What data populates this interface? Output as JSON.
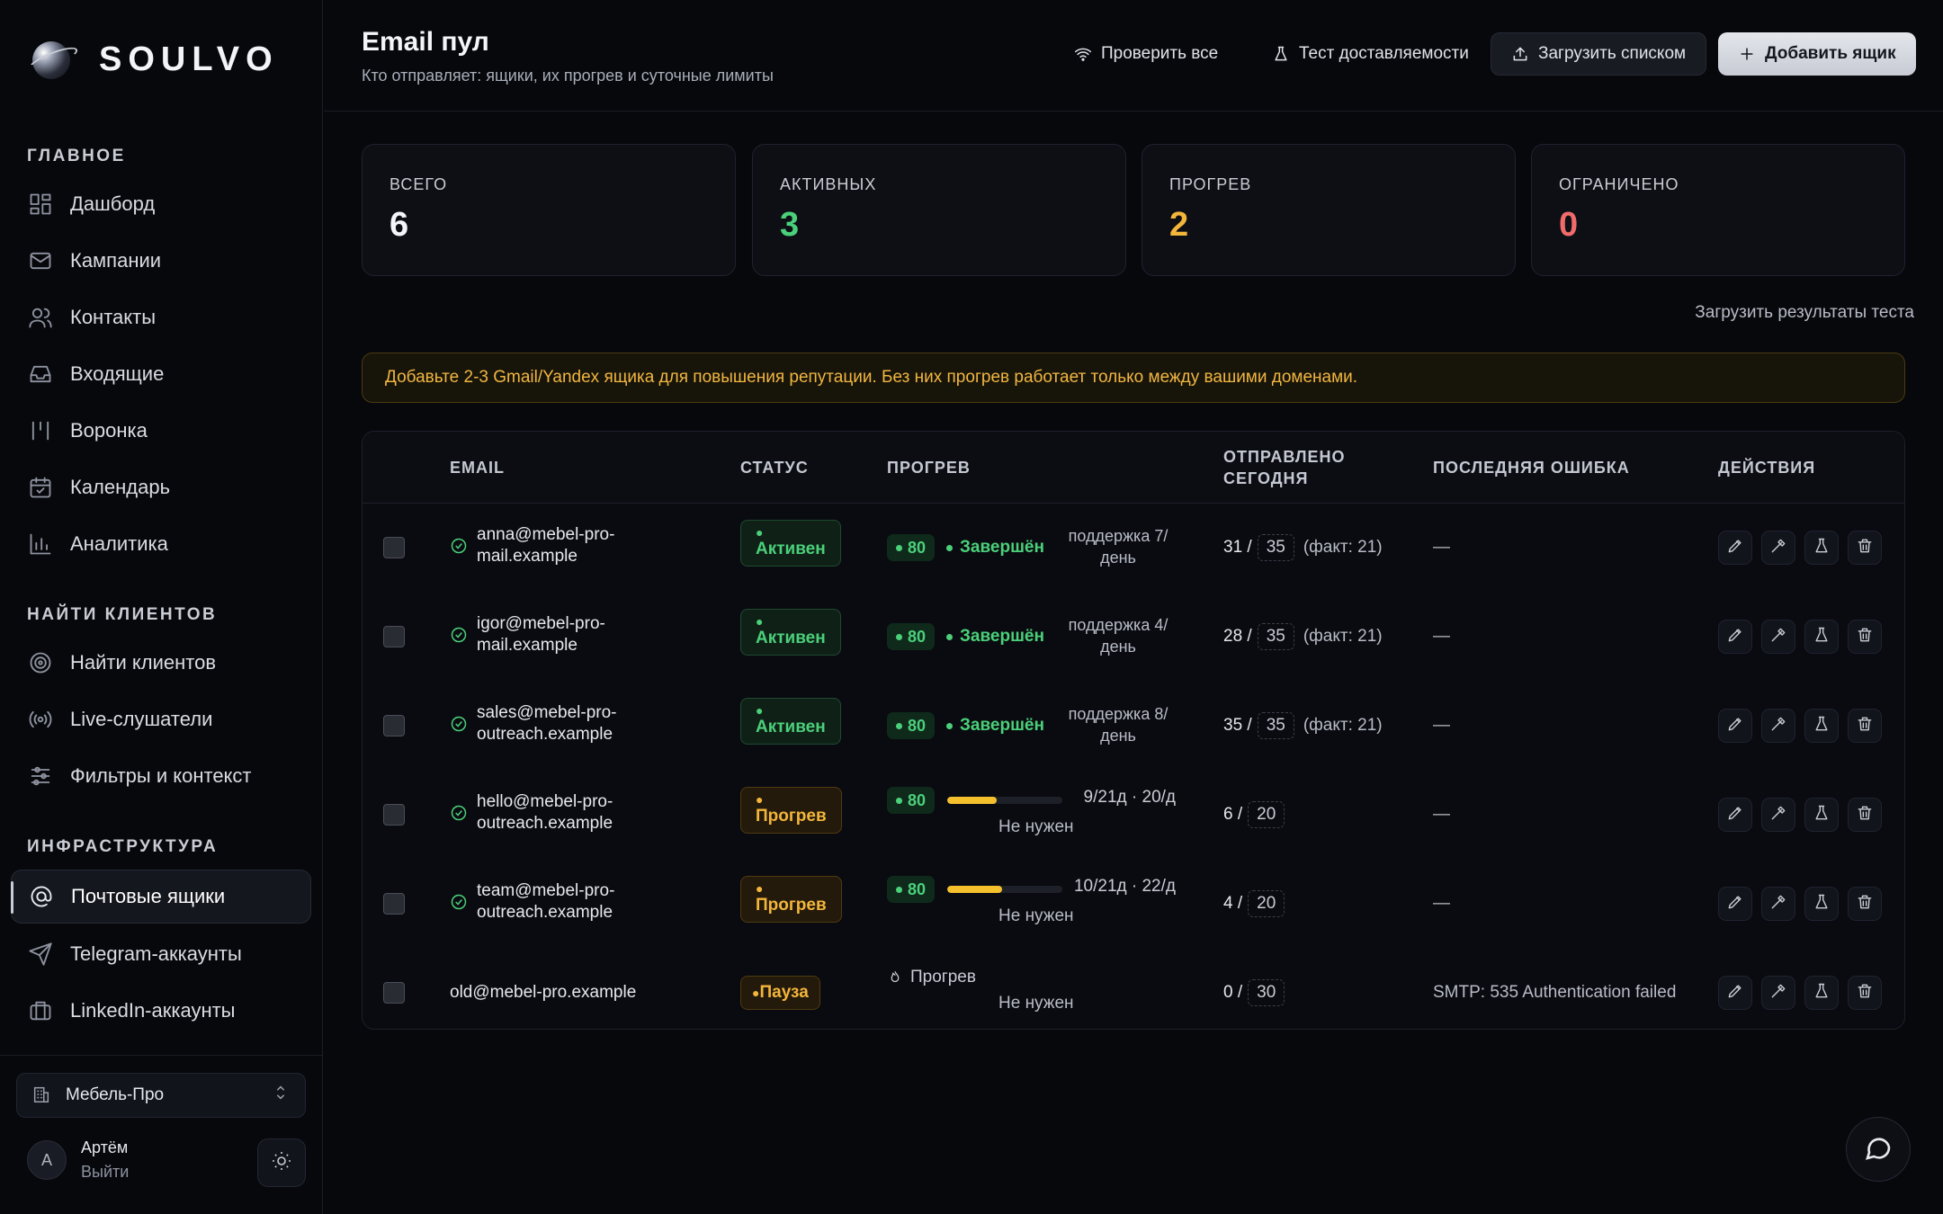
{
  "brand": {
    "name": "SOULVO"
  },
  "sidebar": {
    "sections": [
      {
        "title": "ГЛАВНОЕ",
        "items": [
          {
            "label": "Дашборд",
            "icon": "dashboard-icon"
          },
          {
            "label": "Кампании",
            "icon": "mail-icon"
          },
          {
            "label": "Контакты",
            "icon": "users-icon"
          },
          {
            "label": "Входящие",
            "icon": "inbox-icon"
          },
          {
            "label": "Воронка",
            "icon": "funnel-icon"
          },
          {
            "label": "Календарь",
            "icon": "calendar-icon"
          },
          {
            "label": "Аналитика",
            "icon": "analytics-icon"
          }
        ]
      },
      {
        "title": "НАЙТИ КЛИЕНТОВ",
        "items": [
          {
            "label": "Найти клиентов",
            "icon": "target-icon"
          },
          {
            "label": "Live-слушатели",
            "icon": "broadcast-icon"
          },
          {
            "label": "Фильтры и контекст",
            "icon": "sliders-icon"
          }
        ]
      },
      {
        "title": "ИНФРАСТРУКТУРА",
        "items": [
          {
            "label": "Почтовые ящики",
            "icon": "at-icon",
            "active": true
          },
          {
            "label": "Telegram-аккаунты",
            "icon": "send-icon"
          },
          {
            "label": "LinkedIn-аккаунты",
            "icon": "briefcase-icon"
          }
        ]
      }
    ],
    "org": {
      "name": "Мебель-Про"
    },
    "user": {
      "initial": "A",
      "name": "Артём",
      "logout": "Выйти"
    }
  },
  "header": {
    "title": "Email пул",
    "subtitle": "Кто отправляет: ящики, их прогрев и суточные лимиты",
    "buttons": {
      "check_all": "Проверить все",
      "deliverability": "Тест доставляемости",
      "upload_list": "Загрузить списком",
      "add_box": "Добавить ящик"
    }
  },
  "stats": [
    {
      "label": "ВСЕГО",
      "value": "6",
      "color": "#f4f5f8"
    },
    {
      "label": "АКТИВНЫХ",
      "value": "3",
      "color": "#4bd07a"
    },
    {
      "label": "ПРОГРЕВ",
      "value": "2",
      "color": "#f3b63b"
    },
    {
      "label": "ОГРАНИЧЕНО",
      "value": "0",
      "color": "#f26b6b"
    }
  ],
  "upload_results_link": "Загрузить результаты теста",
  "banner": "Добавьте 2-3 Gmail/Yandex ящика для повышения репутации. Без них прогрев работает только между вашими доменами.",
  "table": {
    "columns": {
      "email": "EMAIL",
      "status": "СТАТУС",
      "warmup": "ПРОГРЕВ",
      "sent_today_1": "ОТПРАВЛЕНО",
      "sent_today_2": "СЕГОДНЯ",
      "last_error": "ПОСЛЕДНЯЯ ОШИБКА",
      "actions": "ДЕЙСТВИЯ"
    },
    "rows": [
      {
        "email_1": "anna@mebel-pro-",
        "email_2": "mail.example",
        "verified": true,
        "status": "Активен",
        "status_kind": "active",
        "score": "80",
        "warm_label": "Завершён",
        "support_1": "поддержка 7/",
        "support_2": "день",
        "sent": "31 /",
        "limit": "35",
        "fact": "(факт: 21)",
        "error": "—"
      },
      {
        "email_1": "igor@mebel-pro-",
        "email_2": "mail.example",
        "verified": true,
        "status": "Активен",
        "status_kind": "active",
        "score": "80",
        "warm_label": "Завершён",
        "support_1": "поддержка 4/",
        "support_2": "день",
        "sent": "28 /",
        "limit": "35",
        "fact": "(факт: 21)",
        "error": "—"
      },
      {
        "email_1": "sales@mebel-pro-",
        "email_2": "outreach.example",
        "verified": true,
        "status": "Активен",
        "status_kind": "active",
        "score": "80",
        "warm_label": "Завершён",
        "support_1": "поддержка 8/",
        "support_2": "день",
        "sent": "35 /",
        "limit": "35",
        "fact": "(факт: 21)",
        "error": "—"
      },
      {
        "email_1": "hello@mebel-pro-",
        "email_2": "outreach.example",
        "verified": true,
        "status": "Прогрев",
        "status_kind": "warm",
        "score": "80",
        "progress": 0.43,
        "warm_days": "9/21д · 20/д",
        "not_needed": "Не нужен",
        "sent": "6 /",
        "limit": "20",
        "error": "—"
      },
      {
        "email_1": "team@mebel-pro-",
        "email_2": "outreach.example",
        "verified": true,
        "status": "Прогрев",
        "status_kind": "warm",
        "score": "80",
        "progress": 0.48,
        "warm_days": "10/21д · 22/д",
        "not_needed": "Не нужен",
        "sent": "4 /",
        "limit": "20",
        "error": "—"
      },
      {
        "email_1": "old@mebel-pro.example",
        "email_2": "",
        "verified": false,
        "status": "Пауза",
        "status_kind": "pause",
        "warm_text": "Прогрев",
        "not_needed": "Не нужен",
        "sent": "0 /",
        "limit": "30",
        "error": "SMTP: 535 Authentication failed"
      }
    ]
  }
}
